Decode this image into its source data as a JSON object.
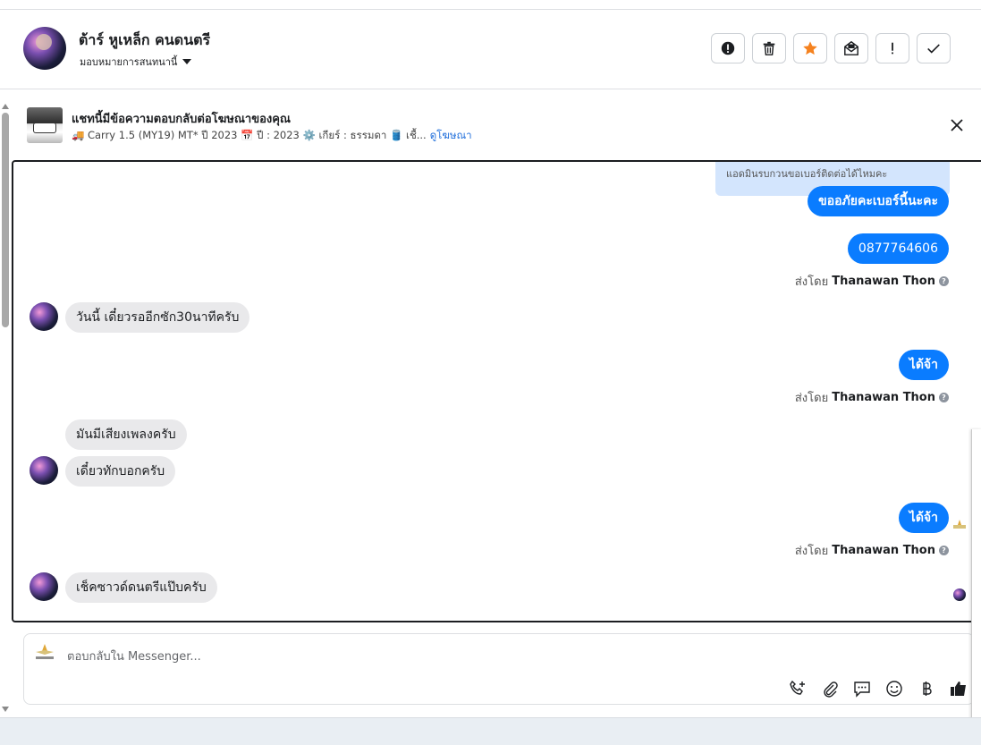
{
  "header": {
    "contact_name": "ต้าร์ หูเหล็ก คนดนตรี",
    "assign_label": "มอบหมายการสนทนานี้"
  },
  "actions": [
    {
      "name": "report-button",
      "icon": "alert-circle-icon"
    },
    {
      "name": "delete-button",
      "icon": "trash-icon"
    },
    {
      "name": "star-button",
      "icon": "star-icon",
      "color": "#f5821f"
    },
    {
      "name": "mark-unread-button",
      "icon": "mail-open-icon"
    },
    {
      "name": "spam-button",
      "icon": "exclamation-icon"
    },
    {
      "name": "done-button",
      "icon": "check-icon"
    }
  ],
  "ad": {
    "title": "แชทนี้มีข้อความตอบกลับต่อโฆษณาของคุณ",
    "subtitle": "🚚 Carry 1.5 (MY19) MT* ปี 2023 📅 ปี : 2023 ⚙️ เกียร์ : ธรรมดา 🛢️ เชื้...",
    "link": "ดูโฆษณา"
  },
  "messages": {
    "quoted_reply": "แอดมินรบกวนขอเบอร์ติดต่อได้ไหมคะ",
    "out1": "ขออภัยคะเบอร์นี้นะคะ",
    "out2": "0877764606",
    "sent_by_prefix": "ส่งโดย",
    "sender_name": "Thanawan Thon",
    "in1": "วันนี้ เดี๋ยวรออีกซัก30นาทีครับ",
    "out3": "ได้จ้า",
    "in2": "มันมีเสียงเพลงครับ",
    "in3": "เดี๋ยวทักบอกครับ",
    "out4": "ได้จ้า",
    "in4": "เช็คซาวด์ดนตรีแป๊บครับ"
  },
  "composer": {
    "placeholder": "ตอบกลับใน Messenger..."
  },
  "colors": {
    "outgoing_bubble": "#0a7cff",
    "incoming_bubble": "#e9e9eb",
    "accent_link": "#216fdb"
  }
}
